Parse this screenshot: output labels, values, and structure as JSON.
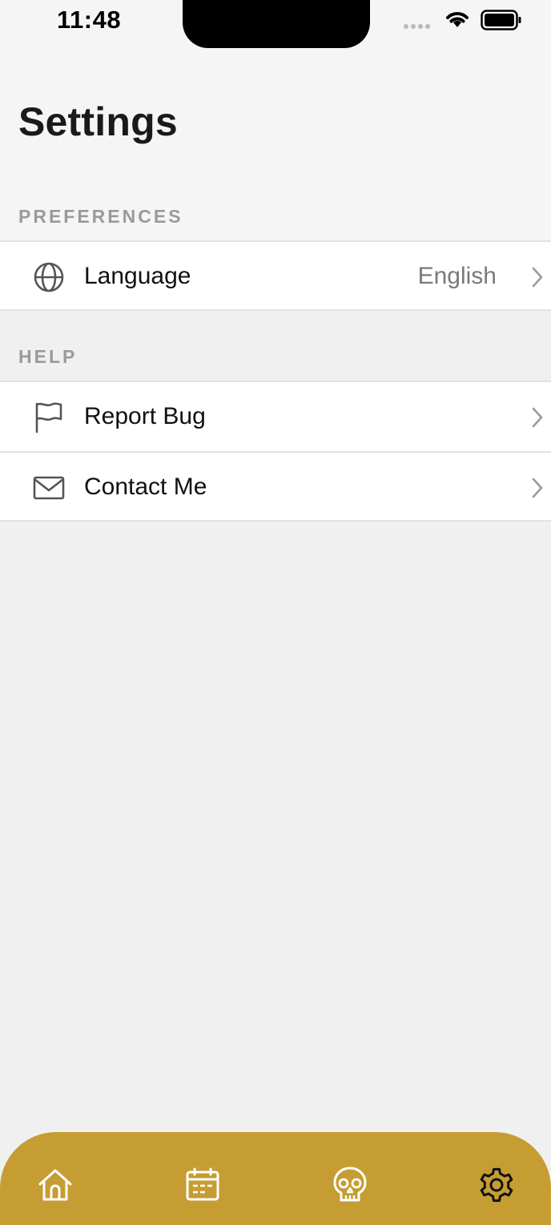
{
  "status_bar": {
    "time": "11:48",
    "wifi_icon": "wifi-icon",
    "battery_icon": "battery-icon"
  },
  "header": {
    "title": "Settings"
  },
  "sections": [
    {
      "title": "PREFERENCES",
      "rows": [
        {
          "icon": "globe-icon",
          "label": "Language",
          "value": "English"
        }
      ]
    },
    {
      "title": "HELP",
      "rows": [
        {
          "icon": "flag-icon",
          "label": "Report Bug",
          "value": ""
        },
        {
          "icon": "envelope-icon",
          "label": "Contact Me",
          "value": ""
        }
      ]
    }
  ],
  "tab_bar": {
    "background": "#c59d33",
    "tabs": [
      {
        "icon": "home-icon",
        "active": false
      },
      {
        "icon": "calendar-icon",
        "active": false
      },
      {
        "icon": "skull-icon",
        "active": false
      },
      {
        "icon": "gear-icon",
        "active": true
      }
    ]
  },
  "colors": {
    "accent": "#c59d33",
    "active_tab_icon": "#111111",
    "inactive_tab_icon": "#ffffff"
  }
}
